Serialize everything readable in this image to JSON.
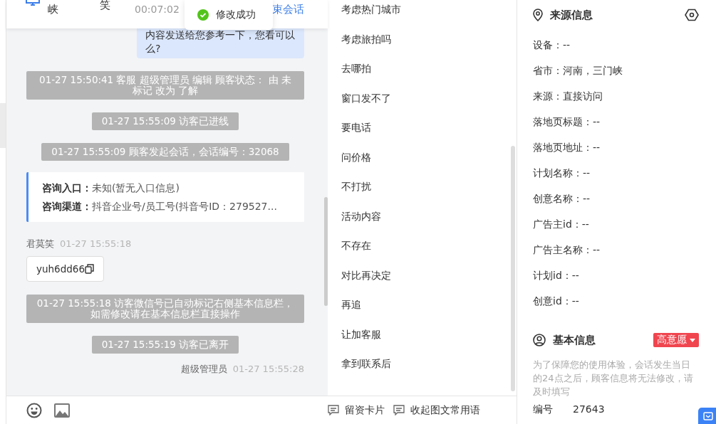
{
  "header": {
    "visitor": "峡",
    "agent": "笑",
    "duration": "00:07:02",
    "end_button": "束会话"
  },
  "toast": {
    "text": "修改成功"
  },
  "messages": [
    {
      "kind": "bubble",
      "text": "内容发送给您参考一下，您看可以么?"
    },
    {
      "kind": "system",
      "text": "01-27 15:50:41 客服 超级管理员 编辑 顾客状态： 由 未标记 改为 了解"
    },
    {
      "kind": "system",
      "text": "01-27 15:55:09 访客已进线"
    },
    {
      "kind": "system",
      "text": "01-27 15:55:09 顾客发起会话，会话编号：32068"
    },
    {
      "kind": "entry_card",
      "rows": [
        {
          "label": "咨询入口：",
          "value": "未知(暂无入口信息)"
        },
        {
          "label": "咨询渠道：",
          "value": "抖音企业号/员工号(抖音号ID：279527..."
        }
      ]
    },
    {
      "kind": "visitor_message",
      "sender": "君莫笑",
      "time": "01-27 15:55:18",
      "text": "yuh6dd66"
    },
    {
      "kind": "system",
      "text": "01-27 15:55:18 访客微信号已自动标记右侧基本信息栏，如需修改请在基本信息栏直接操作"
    },
    {
      "kind": "system",
      "text": "01-27 15:55:19 访客已离开"
    },
    {
      "kind": "agent_header",
      "sender": "超级管理员",
      "time": "01-27 15:55:28"
    }
  ],
  "quick_replies": [
    "考虑热门城市",
    "考虑旅拍吗",
    "去哪拍",
    "窗口发不了",
    "要电话",
    "问价格",
    "不打扰",
    "活动内容",
    "不存在",
    "对比再决定",
    "再追",
    "让加客服",
    "拿到联系后"
  ],
  "composer_actions": [
    "留资卡片",
    "收起图文常用语"
  ],
  "source_info": {
    "title": "来源信息",
    "lines": [
      "设备：--",
      "省市：河南，三门峡",
      "来源：直接访问",
      "落地页标题：--",
      "落地页地址：--",
      "计划名称：--",
      "创意名称：--",
      "广告主id：--",
      "广告主名称：--",
      "计划id：--",
      "创意id：--"
    ]
  },
  "basic_info": {
    "title": "基本信息",
    "intent_tag": "高意愿",
    "notice": "为了保障您的使用体验，会话发生当日的24点之后，顾客信息将无法修改，请及时填写",
    "fields": [
      {
        "label": "编号",
        "value": "27643"
      }
    ]
  }
}
